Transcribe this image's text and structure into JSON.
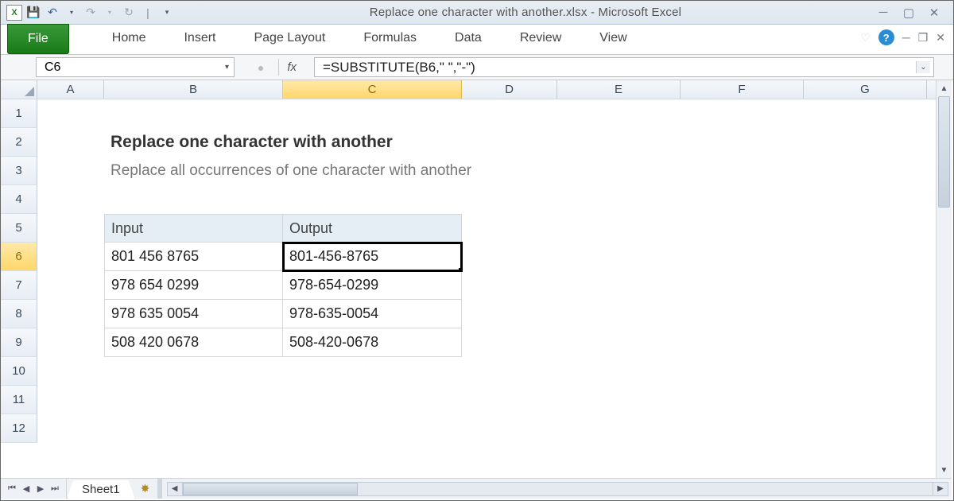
{
  "window": {
    "title": "Replace one character with another.xlsx  -  Microsoft Excel"
  },
  "ribbon": {
    "file": "File",
    "tabs": [
      "Home",
      "Insert",
      "Page Layout",
      "Formulas",
      "Data",
      "Review",
      "View"
    ]
  },
  "formula_bar": {
    "namebox": "C6",
    "fx_label": "fx",
    "formula": "=SUBSTITUTE(B6,\" \",\"-\")"
  },
  "columns": [
    "A",
    "B",
    "C",
    "D",
    "E",
    "F",
    "G"
  ],
  "selected_column": "C",
  "row_numbers": [
    "1",
    "2",
    "3",
    "4",
    "5",
    "6",
    "7",
    "8",
    "9",
    "10",
    "11",
    "12"
  ],
  "selected_row": "6",
  "content": {
    "title": "Replace one character with another",
    "subtitle": "Replace all occurrences of one character with another",
    "headers": {
      "input": "Input",
      "output": "Output"
    },
    "rows": [
      {
        "input": "801 456 8765",
        "output": "801-456-8765"
      },
      {
        "input": "978 654 0299",
        "output": "978-654-0299"
      },
      {
        "input": "978 635 0054",
        "output": "978-635-0054"
      },
      {
        "input": "508 420 0678",
        "output": "508-420-0678"
      }
    ]
  },
  "sheet": {
    "name": "Sheet1"
  }
}
